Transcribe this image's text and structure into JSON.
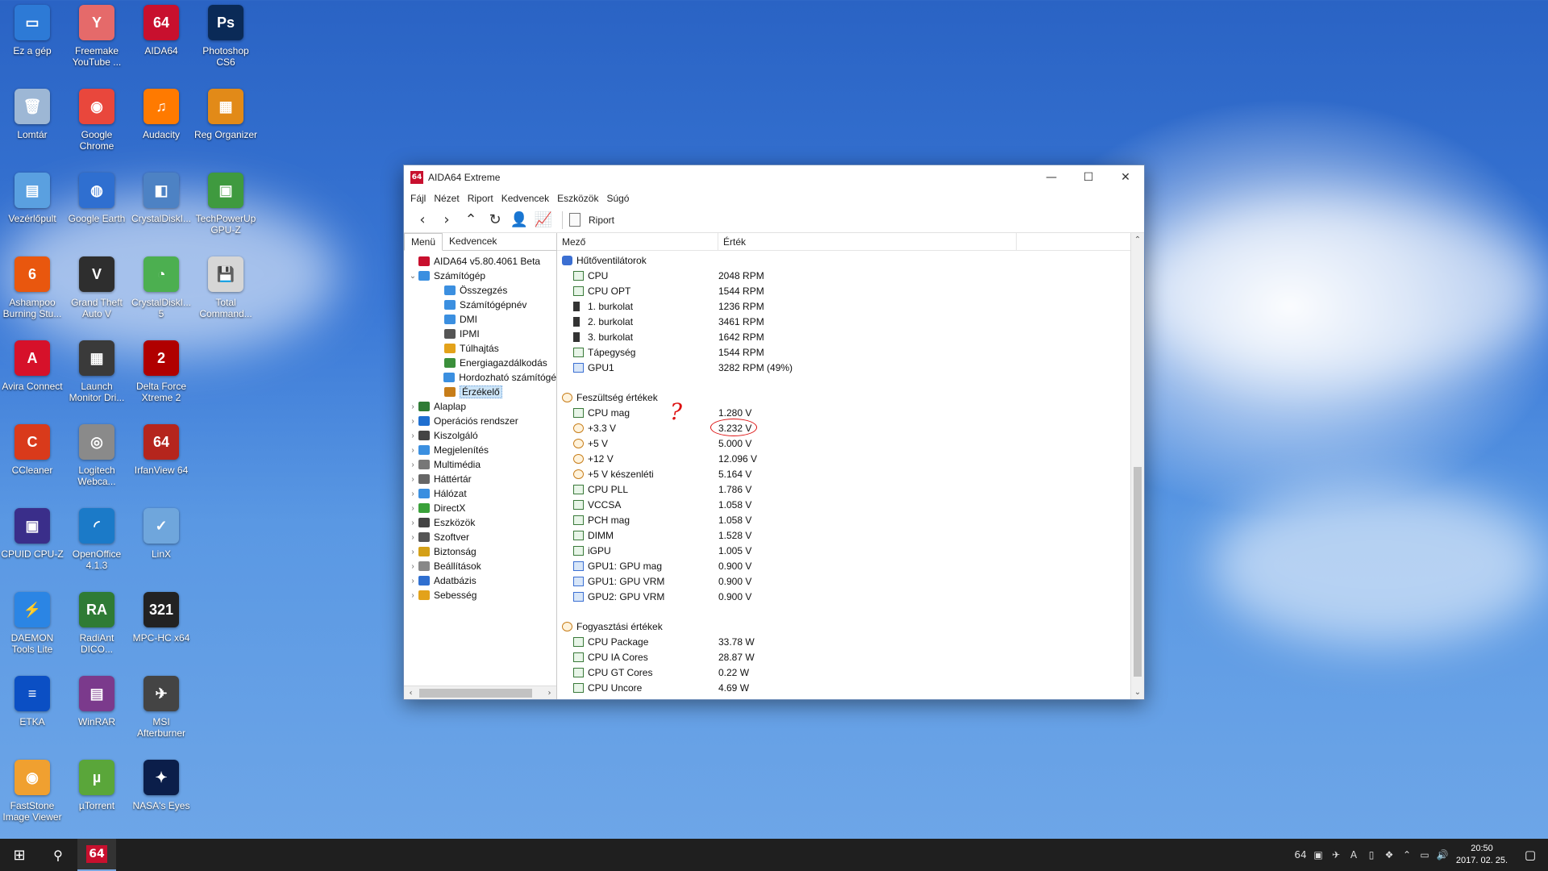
{
  "desktop": {
    "icons": [
      {
        "label": "Ez a gép",
        "color": "#2d7ad6",
        "glyph": "▭"
      },
      {
        "label": "Freemake YouTube ...",
        "color": "#e56a6a",
        "glyph": "Y"
      },
      {
        "label": "AIDA64",
        "color": "#c8102e",
        "glyph": "64"
      },
      {
        "label": "Photoshop CS6",
        "color": "#0a2a57",
        "glyph": "Ps"
      },
      {
        "label": "Lomtár",
        "color": "#9db7d5",
        "glyph": "🗑"
      },
      {
        "label": "Google Chrome",
        "color": "#e9473c",
        "glyph": "◉"
      },
      {
        "label": "Audacity",
        "color": "#ff7a00",
        "glyph": "♫"
      },
      {
        "label": "Reg Organizer",
        "color": "#e28a18",
        "glyph": "▦"
      },
      {
        "label": "Vezérlőpult",
        "color": "#5aa0e0",
        "glyph": "▤"
      },
      {
        "label": "Google Earth",
        "color": "#2f6fd0",
        "glyph": "◍"
      },
      {
        "label": "CrystalDiskI...",
        "color": "#4d82c4",
        "glyph": "◧"
      },
      {
        "label": "TechPowerUp GPU-Z",
        "color": "#3f9a3f",
        "glyph": "▣"
      },
      {
        "label": "Ashampoo Burning Stu...",
        "color": "#e9570e",
        "glyph": "6"
      },
      {
        "label": "Grand Theft Auto V",
        "color": "#2e2e2e",
        "glyph": "V"
      },
      {
        "label": "CrystalDiskI... 5",
        "color": "#4caf50",
        "glyph": "◔"
      },
      {
        "label": "Total Command...",
        "color": "#d6d6d6",
        "glyph": "💾"
      },
      {
        "label": "Avira Connect",
        "color": "#d6112a",
        "glyph": "A"
      },
      {
        "label": "Launch Monitor Dri...",
        "color": "#3a3a3a",
        "glyph": "▦"
      },
      {
        "label": "Delta Force Xtreme 2",
        "color": "#b00000",
        "glyph": "2"
      },
      {
        "label": "",
        "color": "transparent",
        "glyph": ""
      },
      {
        "label": "CCleaner",
        "color": "#d93a1b",
        "glyph": "C"
      },
      {
        "label": "Logitech Webca...",
        "color": "#8a8a8a",
        "glyph": "◎"
      },
      {
        "label": "IrfanView 64",
        "color": "#b5251d",
        "glyph": "64"
      },
      {
        "label": "",
        "color": "transparent",
        "glyph": ""
      },
      {
        "label": "CPUID CPU-Z",
        "color": "#3a2e8a",
        "glyph": "▣"
      },
      {
        "label": "OpenOffice 4.1.3",
        "color": "#1b7ac8",
        "glyph": "◜"
      },
      {
        "label": "LinX",
        "color": "#6fa6dc",
        "glyph": "✓"
      },
      {
        "label": "",
        "color": "transparent",
        "glyph": ""
      },
      {
        "label": "DAEMON Tools Lite",
        "color": "#2b85e4",
        "glyph": "⚡"
      },
      {
        "label": "RadiAnt DICO...",
        "color": "#2f7b35",
        "glyph": "RA"
      },
      {
        "label": "MPC-HC x64",
        "color": "#222",
        "glyph": "321"
      },
      {
        "label": "",
        "color": "transparent",
        "glyph": ""
      },
      {
        "label": "ETKA",
        "color": "#0b4fc4",
        "glyph": "≡"
      },
      {
        "label": "WinRAR",
        "color": "#7b3a8c",
        "glyph": "▤"
      },
      {
        "label": "MSI Afterburner",
        "color": "#444",
        "glyph": "✈"
      },
      {
        "label": "",
        "color": "transparent",
        "glyph": ""
      },
      {
        "label": "FastStone Image Viewer",
        "color": "#f0a030",
        "glyph": "◉"
      },
      {
        "label": "µTorrent",
        "color": "#5aa63a",
        "glyph": "µ"
      },
      {
        "label": "NASA's Eyes",
        "color": "#0b1e4a",
        "glyph": "✦"
      }
    ]
  },
  "window": {
    "title": "AIDA64 Extreme",
    "icon": "aida64-icon",
    "controls": {
      "minimize": "—",
      "maximize": "☐",
      "close": "✕"
    },
    "menu": [
      "Fájl",
      "Nézet",
      "Riport",
      "Kedvencek",
      "Eszközök",
      "Súgó"
    ],
    "toolbar": {
      "report_label": "Riport"
    },
    "left_tabs": [
      "Menü",
      "Kedvencek"
    ],
    "tree": [
      {
        "label": "AIDA64 v5.80.4061 Beta",
        "level": 0,
        "arrow": "",
        "color": "#c8102e"
      },
      {
        "label": "Számítógép",
        "level": 0,
        "arrow": "⌄",
        "color": "#3b8fe0"
      },
      {
        "label": "Összegzés",
        "level": 2,
        "arrow": "",
        "color": "#3b8fe0"
      },
      {
        "label": "Számítógépnév",
        "level": 2,
        "arrow": "",
        "color": "#3b8fe0"
      },
      {
        "label": "DMI",
        "level": 2,
        "arrow": "",
        "color": "#3b8fe0"
      },
      {
        "label": "IPMI",
        "level": 2,
        "arrow": "",
        "color": "#555"
      },
      {
        "label": "Túlhajtás",
        "level": 2,
        "arrow": "",
        "color": "#e3a21a"
      },
      {
        "label": "Energiagazdálkodás",
        "level": 2,
        "arrow": "",
        "color": "#3b8f3b"
      },
      {
        "label": "Hordozható számítógé",
        "level": 2,
        "arrow": "",
        "color": "#3b8fe0"
      },
      {
        "label": "Érzékelő",
        "level": 2,
        "arrow": "",
        "color": "#c77d19",
        "selected": true
      },
      {
        "label": "Alaplap",
        "level": 0,
        "arrow": "›",
        "color": "#2f7b35"
      },
      {
        "label": "Operációs rendszer",
        "level": 0,
        "arrow": "›",
        "color": "#1f6fd0"
      },
      {
        "label": "Kiszolgáló",
        "level": 0,
        "arrow": "›",
        "color": "#444"
      },
      {
        "label": "Megjelenítés",
        "level": 0,
        "arrow": "›",
        "color": "#3b8fe0"
      },
      {
        "label": "Multimédia",
        "level": 0,
        "arrow": "›",
        "color": "#777"
      },
      {
        "label": "Háttértár",
        "level": 0,
        "arrow": "›",
        "color": "#666"
      },
      {
        "label": "Hálózat",
        "level": 0,
        "arrow": "›",
        "color": "#3b8fe0"
      },
      {
        "label": "DirectX",
        "level": 0,
        "arrow": "›",
        "color": "#3aa13a"
      },
      {
        "label": "Eszközök",
        "level": 0,
        "arrow": "›",
        "color": "#444"
      },
      {
        "label": "Szoftver",
        "level": 0,
        "arrow": "›",
        "color": "#555"
      },
      {
        "label": "Biztonság",
        "level": 0,
        "arrow": "›",
        "color": "#d4a017"
      },
      {
        "label": "Beállítások",
        "level": 0,
        "arrow": "›",
        "color": "#888"
      },
      {
        "label": "Adatbázis",
        "level": 0,
        "arrow": "›",
        "color": "#2f6fd0"
      },
      {
        "label": "Sebesség",
        "level": 0,
        "arrow": "›",
        "color": "#e3a21a"
      }
    ],
    "columns": {
      "field": "Mező",
      "value": "Érték"
    },
    "groups": [
      {
        "name": "Hűtőventilátorok",
        "icon": "fan-icon",
        "rows": [
          {
            "f": "CPU",
            "v": "2048 RPM",
            "i": "board"
          },
          {
            "f": "CPU OPT",
            "v": "1544 RPM",
            "i": "board"
          },
          {
            "f": "1. burkolat",
            "v": "1236 RPM",
            "i": "dark"
          },
          {
            "f": "2. burkolat",
            "v": "3461 RPM",
            "i": "dark"
          },
          {
            "f": "3. burkolat",
            "v": "1642 RPM",
            "i": "dark"
          },
          {
            "f": "Tápegység",
            "v": "1544 RPM",
            "i": "board"
          },
          {
            "f": "GPU1",
            "v": "3282 RPM  (49%)",
            "i": "gpu"
          }
        ]
      },
      {
        "name": "Feszültség értékek",
        "icon": "voltage-icon",
        "rows": [
          {
            "f": "CPU mag",
            "v": "1.280 V",
            "i": "board"
          },
          {
            "f": "+3.3 V",
            "v": "3.232 V",
            "i": "sens",
            "circled": true
          },
          {
            "f": "+5 V",
            "v": "5.000 V",
            "i": "sens"
          },
          {
            "f": "+12 V",
            "v": "12.096 V",
            "i": "sens"
          },
          {
            "f": "+5 V készenléti",
            "v": "5.164 V",
            "i": "sens"
          },
          {
            "f": "CPU PLL",
            "v": "1.786 V",
            "i": "board"
          },
          {
            "f": "VCCSA",
            "v": "1.058 V",
            "i": "board"
          },
          {
            "f": "PCH mag",
            "v": "1.058 V",
            "i": "board"
          },
          {
            "f": "DIMM",
            "v": "1.528 V",
            "i": "board"
          },
          {
            "f": "iGPU",
            "v": "1.005 V",
            "i": "board"
          },
          {
            "f": "GPU1: GPU mag",
            "v": "0.900 V",
            "i": "gpu"
          },
          {
            "f": "GPU1: GPU VRM",
            "v": "0.900 V",
            "i": "gpu"
          },
          {
            "f": "GPU2: GPU VRM",
            "v": "0.900 V",
            "i": "gpu"
          }
        ]
      },
      {
        "name": "Fogyasztási értékek",
        "icon": "power-icon",
        "rows": [
          {
            "f": "CPU Package",
            "v": "33.78 W",
            "i": "board"
          },
          {
            "f": "CPU IA Cores",
            "v": "28.87 W",
            "i": "board"
          },
          {
            "f": "CPU GT Cores",
            "v": "0.22 W",
            "i": "board"
          },
          {
            "f": "CPU Uncore",
            "v": "4.69 W",
            "i": "board"
          }
        ]
      }
    ],
    "annotation": "?"
  },
  "taskbar": {
    "start": "⊞",
    "search": "⚲",
    "app": "64",
    "clock_time": "20:50",
    "clock_date": "2017. 02. 25.",
    "tray": [
      "64",
      "▣",
      "✈",
      "A",
      "▯",
      "❖",
      "⌃",
      "▭",
      "🔊"
    ],
    "notification": "▢"
  }
}
